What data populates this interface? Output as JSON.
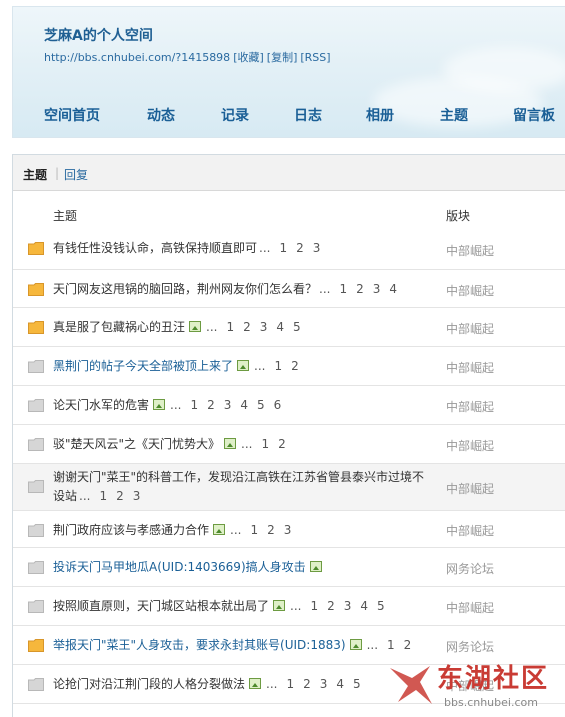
{
  "header": {
    "title": "芝麻A的个人空间",
    "url": "http://bbs.cnhubei.com/?1415898",
    "links": [
      "[收藏]",
      "[复制]",
      "[RSS]"
    ],
    "nav": [
      "空间首页",
      "动态",
      "记录",
      "日志",
      "相册",
      "主题",
      "留言板"
    ]
  },
  "tabs": {
    "active": "主题",
    "reply": "回复"
  },
  "columns": {
    "topic": "主题",
    "forum": "版块"
  },
  "rows": [
    {
      "title": "有钱任性没钱认命，高铁保持顺直即可",
      "img": false,
      "pages": [
        "1",
        "2",
        "3"
      ],
      "forum": "中部崛起",
      "folder": "orange",
      "blue": false
    },
    {
      "title": "天门网友这甩锅的脑回路，荆州网友你们怎么看？",
      "img": false,
      "pages": [
        "1",
        "2",
        "3",
        "4"
      ],
      "forum": "中部崛起",
      "folder": "orange",
      "blue": false
    },
    {
      "title": "真是服了包藏祸心的丑汪",
      "img": true,
      "pages": [
        "1",
        "2",
        "3",
        "4",
        "5"
      ],
      "forum": "中部崛起",
      "folder": "orange",
      "blue": false
    },
    {
      "title": "黑荆门的帖子今天全部被顶上来了",
      "img": true,
      "pages": [
        "1",
        "2"
      ],
      "forum": "中部崛起",
      "folder": "gray",
      "blue": true
    },
    {
      "title": "论天门水军的危害",
      "img": true,
      "pages": [
        "1",
        "2",
        "3",
        "4",
        "5",
        "6"
      ],
      "forum": "中部崛起",
      "folder": "gray",
      "blue": false
    },
    {
      "title": "驳\"楚天风云\"之《天门忧势大》",
      "img": true,
      "pages": [
        "1",
        "2"
      ],
      "forum": "中部崛起",
      "folder": "gray",
      "blue": false
    },
    {
      "title": "谢谢天门\"菜王\"的科普工作，发现沿江高铁在江苏省管县泰兴市过境不设站",
      "img": false,
      "pages": [
        "1",
        "2",
        "3"
      ],
      "forum": "中部崛起",
      "folder": "gray",
      "blue": false
    },
    {
      "title": "荆门政府应该与孝感通力合作",
      "img": true,
      "pages": [
        "1",
        "2",
        "3"
      ],
      "forum": "中部崛起",
      "folder": "gray",
      "blue": false
    },
    {
      "title": "投诉天门马甲地瓜A(UID:1403669)搞人身攻击",
      "img": true,
      "pages": [],
      "forum": "网务论坛",
      "folder": "gray",
      "blue": true
    },
    {
      "title": "按照顺直原则，天门城区站根本就出局了",
      "img": true,
      "pages": [
        "1",
        "2",
        "3",
        "4",
        "5"
      ],
      "forum": "中部崛起",
      "folder": "gray",
      "blue": false
    },
    {
      "title": "举报天门\"菜王\"人身攻击，要求永封其账号(UID:1883)",
      "img": true,
      "pages": [
        "1",
        "2"
      ],
      "forum": "网务论坛",
      "folder": "orange",
      "blue": true
    },
    {
      "title": "论抢门对沿江荆门段的人格分裂做法",
      "img": true,
      "pages": [
        "1",
        "2",
        "3",
        "4",
        "5"
      ],
      "forum": "中部崛起",
      "folder": "gray",
      "blue": false
    }
  ],
  "watermark": {
    "text": "东湖社区",
    "url": "bbs.cnhubei.com"
  },
  "colors": {
    "link": "#1a5f96",
    "orange_folder": "#f6b73c",
    "gray_folder": "#d6d6d6",
    "brand_red": "#c93b34"
  }
}
